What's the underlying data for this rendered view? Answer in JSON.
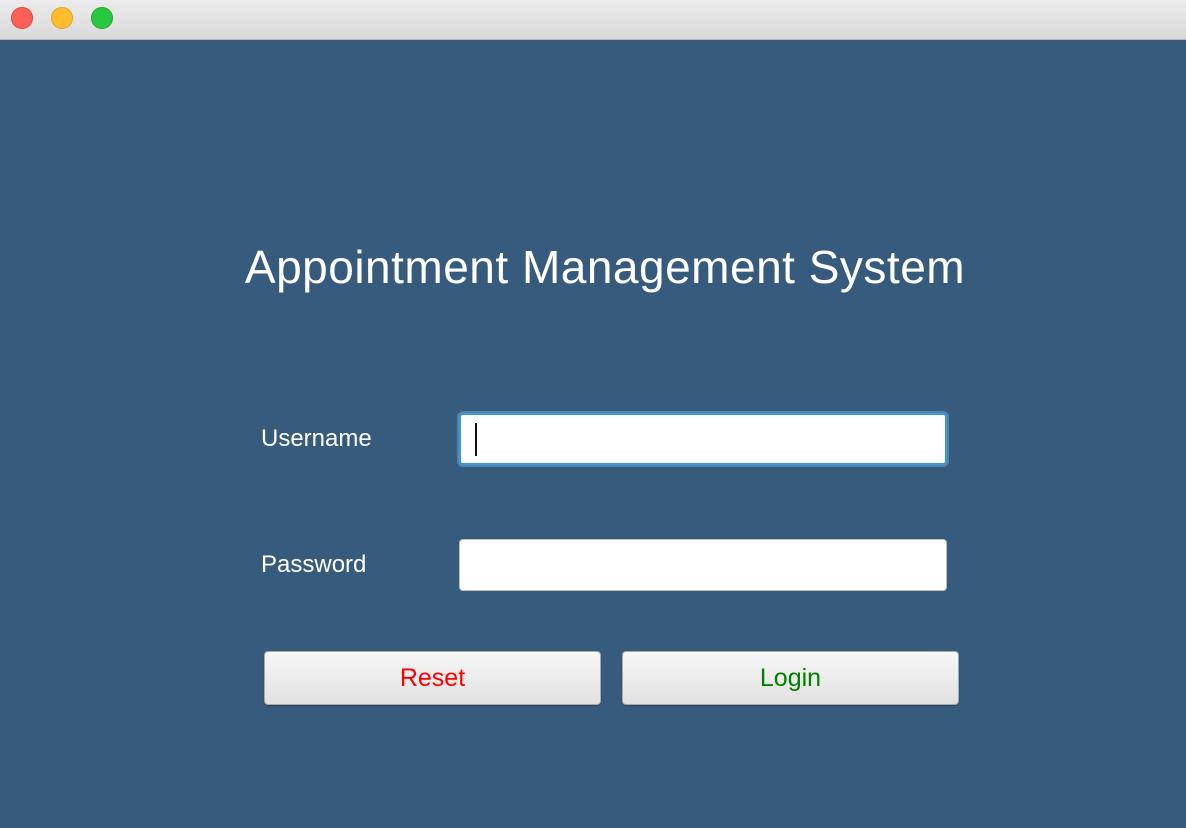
{
  "window": {
    "title_bar_buttons": [
      "close",
      "minimize",
      "maximize"
    ]
  },
  "app": {
    "title": "Appointment Management System"
  },
  "form": {
    "username_label": "Username",
    "username_value": "",
    "password_label": "Password",
    "password_value": "",
    "reset_label": "Reset",
    "login_label": "Login"
  },
  "colors": {
    "background": "#365b7c",
    "reset_text": "#ff0000",
    "login_text": "#008000",
    "focus_ring": "#3b99d8"
  }
}
